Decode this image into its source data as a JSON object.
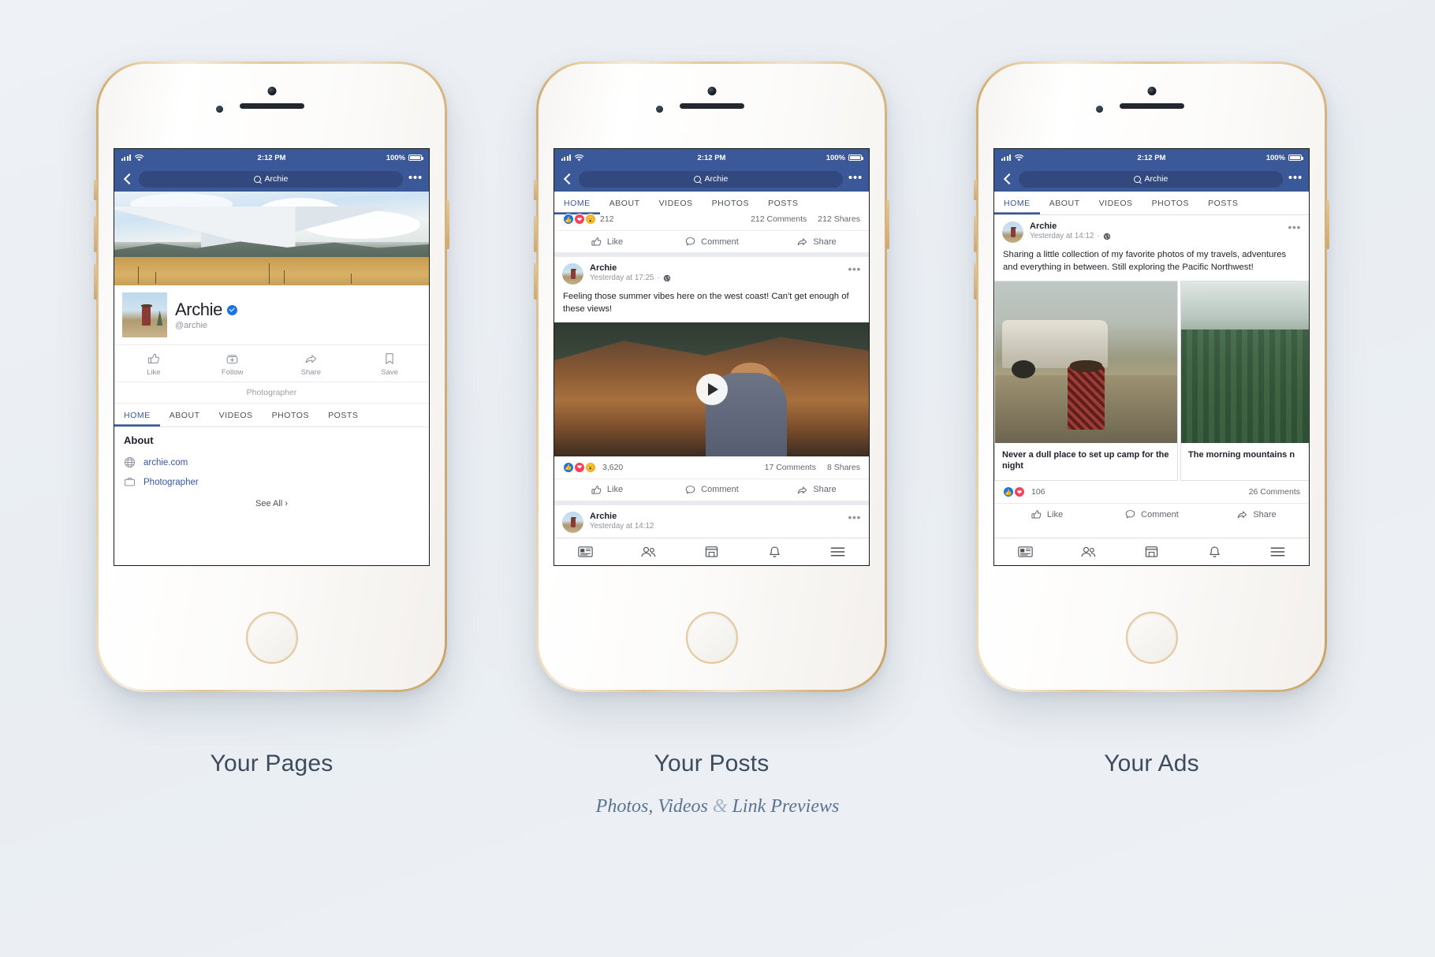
{
  "status_bar": {
    "time": "2:12 PM",
    "battery": "100%"
  },
  "nav": {
    "search_value": "Archie",
    "back_icon": "back-arrow-icon",
    "more_icon": "more-options-icon"
  },
  "profile": {
    "name": "Archie",
    "handle": "@archie",
    "verified": true,
    "tagline": "Photographer",
    "actions": [
      {
        "label": "Like",
        "icon": "thumbs-up-icon"
      },
      {
        "label": "Follow",
        "icon": "follow-plus-icon"
      },
      {
        "label": "Share",
        "icon": "share-arrow-icon"
      },
      {
        "label": "Save",
        "icon": "bookmark-icon"
      }
    ],
    "about": {
      "heading": "About",
      "rows": [
        {
          "icon": "globe-icon",
          "label": "archie.com"
        },
        {
          "icon": "briefcase-icon",
          "label": "Photographer"
        }
      ],
      "see_all": "See All"
    }
  },
  "tabs": [
    {
      "label": "HOME",
      "active": true
    },
    {
      "label": "ABOUT",
      "active": false
    },
    {
      "label": "VIDEOS",
      "active": false
    },
    {
      "label": "PHOTOS",
      "active": false
    },
    {
      "label": "POSTS",
      "active": false
    }
  ],
  "posts_screen": {
    "partial_post": {
      "reaction_count": "212",
      "comments": "212 Comments",
      "shares": "212 Shares"
    },
    "video_post": {
      "author": "Archie",
      "timestamp": "Yesterday at 17:25",
      "privacy_icon": "globe-icon",
      "more_icon": "more-options-icon",
      "text": "Feeling those summer vibes here on the west coast! Can't get enough of these views!",
      "play_icon": "play-icon",
      "reaction_count": "3,620",
      "comments": "17 Comments",
      "shares": "8 Shares"
    },
    "next_post": {
      "author": "Archie",
      "timestamp": "Yesterday at 14:12"
    }
  },
  "ads_screen": {
    "post": {
      "author": "Archie",
      "timestamp": "Yesterday at 14:12",
      "privacy_icon": "globe-icon",
      "more_icon": "more-options-icon",
      "text": "Sharing a little collection of my favorite photos of my travels, adventures and everything in between. Still exploring the Pacific Northwest!"
    },
    "cards": [
      {
        "caption": "Never a dull place to set up camp for the night"
      },
      {
        "caption": "The morning mountains n"
      }
    ],
    "reaction_count": "106",
    "comments": "26 Comments"
  },
  "post_actions": [
    {
      "label": "Like",
      "icon": "thumbs-up-icon"
    },
    {
      "label": "Comment",
      "icon": "comment-bubble-icon"
    },
    {
      "label": "Share",
      "icon": "share-arrow-icon"
    }
  ],
  "bottom_tabs": [
    {
      "icon": "news-feed-icon"
    },
    {
      "icon": "friends-icon"
    },
    {
      "icon": "marketplace-icon"
    },
    {
      "icon": "notifications-bell-icon"
    },
    {
      "icon": "menu-hamburger-icon"
    }
  ],
  "captions": {
    "pages": "Your Pages",
    "posts": "Your Posts",
    "ads": "Your Ads",
    "subtitle_1": "Photos, Videos",
    "subtitle_amp": "&",
    "subtitle_2": "Link Previews"
  },
  "colors": {
    "fb_blue": "#3b5998",
    "accent": "#365899",
    "like_blue": "#1b74e4",
    "love_red": "#f3425f",
    "wow_yellow": "#f7b125"
  }
}
